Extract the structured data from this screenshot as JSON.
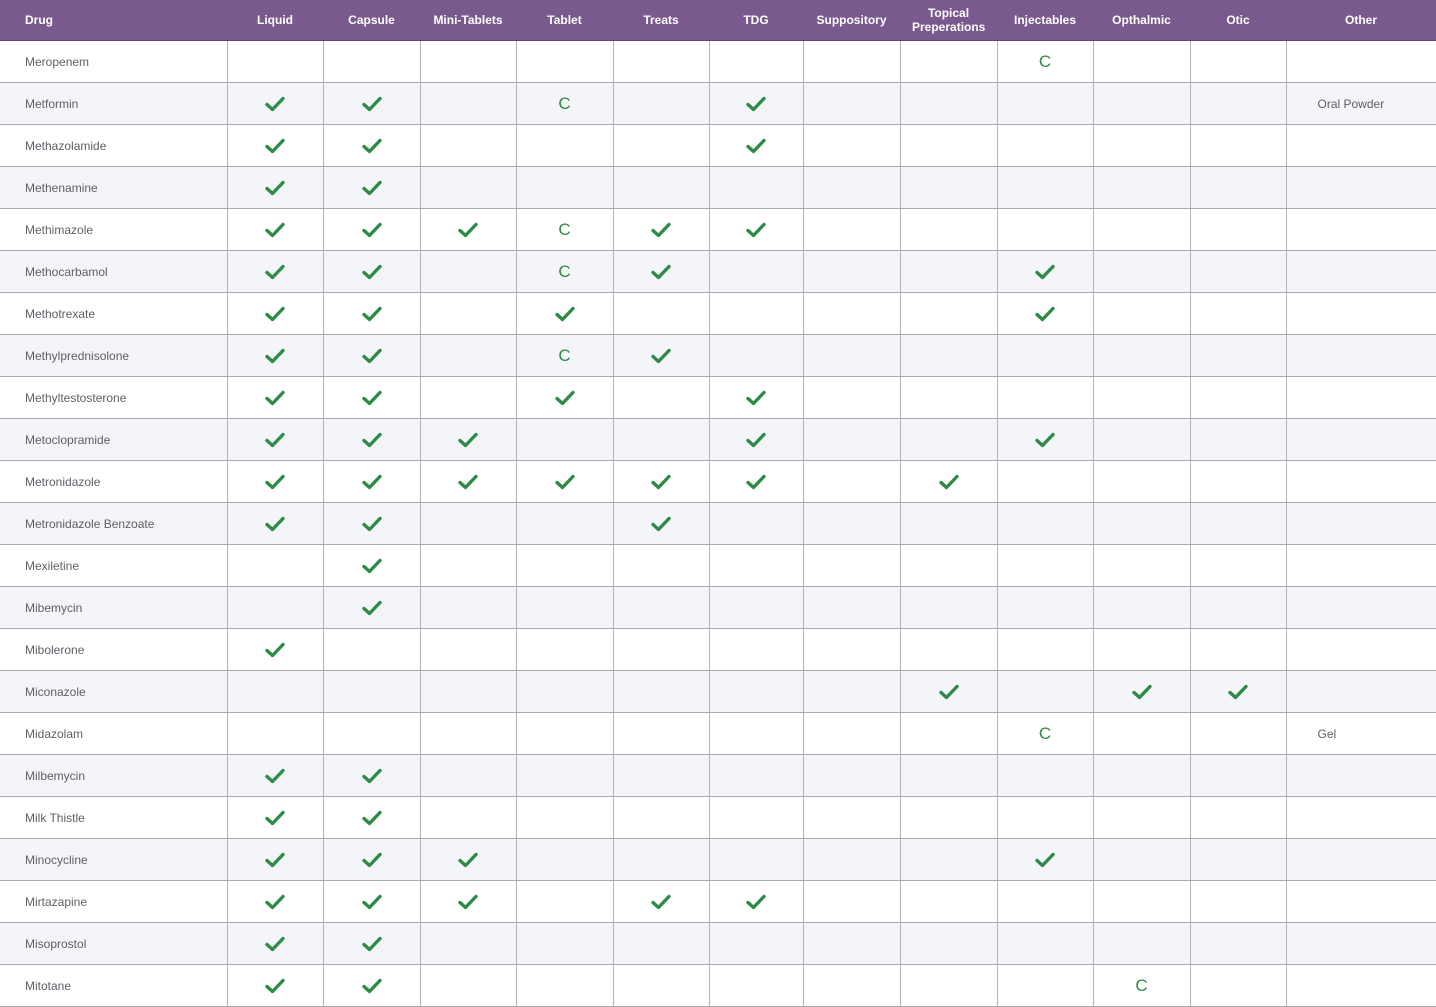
{
  "colors": {
    "header_bg": "#7a5a8e",
    "check": "#2e8b46",
    "row_alt": "#f4f5f9",
    "text": "#5e5e66"
  },
  "legend": {
    "check_icon": "check-icon",
    "c_mark": "C"
  },
  "columns": [
    "Drug",
    "Liquid",
    "Capsule",
    "Mini-Tablets",
    "Tablet",
    "Treats",
    "TDG",
    "Suppository",
    "Topical Preperations",
    "Injectables",
    "Opthalmic",
    "Otic",
    "Other"
  ],
  "rows": [
    {
      "drug": "Meropenem",
      "marks": [
        "",
        "",
        "",
        "",
        "",
        "",
        "",
        "",
        "C",
        "",
        ""
      ],
      "other": ""
    },
    {
      "drug": "Metformin",
      "marks": [
        "check",
        "check",
        "",
        "C",
        "",
        "check",
        "",
        "",
        "",
        "",
        ""
      ],
      "other": "Oral Powder"
    },
    {
      "drug": "Methazolamide",
      "marks": [
        "check",
        "check",
        "",
        "",
        "",
        "check",
        "",
        "",
        "",
        "",
        ""
      ],
      "other": ""
    },
    {
      "drug": "Methenamine",
      "marks": [
        "check",
        "check",
        "",
        "",
        "",
        "",
        "",
        "",
        "",
        "",
        ""
      ],
      "other": ""
    },
    {
      "drug": "Methimazole",
      "marks": [
        "check",
        "check",
        "check",
        "C",
        "check",
        "check",
        "",
        "",
        "",
        "",
        ""
      ],
      "other": ""
    },
    {
      "drug": "Methocarbamol",
      "marks": [
        "check",
        "check",
        "",
        "C",
        "check",
        "",
        "",
        "",
        "check",
        "",
        ""
      ],
      "other": ""
    },
    {
      "drug": "Methotrexate",
      "marks": [
        "check",
        "check",
        "",
        "check",
        "",
        "",
        "",
        "",
        "check",
        "",
        ""
      ],
      "other": ""
    },
    {
      "drug": "Methylprednisolone",
      "marks": [
        "check",
        "check",
        "",
        "C",
        "check",
        "",
        "",
        "",
        "",
        "",
        ""
      ],
      "other": ""
    },
    {
      "drug": "Methyltestosterone",
      "marks": [
        "check",
        "check",
        "",
        "check",
        "",
        "check",
        "",
        "",
        "",
        "",
        ""
      ],
      "other": ""
    },
    {
      "drug": "Metoclopramide",
      "marks": [
        "check",
        "check",
        "check",
        "",
        "",
        "check",
        "",
        "",
        "check",
        "",
        ""
      ],
      "other": ""
    },
    {
      "drug": "Metronidazole",
      "marks": [
        "check",
        "check",
        "check",
        "check",
        "check",
        "check",
        "",
        "check",
        "",
        "",
        ""
      ],
      "other": ""
    },
    {
      "drug": "Metronidazole Benzoate",
      "marks": [
        "check",
        "check",
        "",
        "",
        "check",
        "",
        "",
        "",
        "",
        "",
        ""
      ],
      "other": ""
    },
    {
      "drug": "Mexiletine",
      "marks": [
        "",
        "check",
        "",
        "",
        "",
        "",
        "",
        "",
        "",
        "",
        ""
      ],
      "other": ""
    },
    {
      "drug": "Mibemycin",
      "marks": [
        "",
        "check",
        "",
        "",
        "",
        "",
        "",
        "",
        "",
        "",
        ""
      ],
      "other": ""
    },
    {
      "drug": "Mibolerone",
      "marks": [
        "check",
        "",
        "",
        "",
        "",
        "",
        "",
        "",
        "",
        "",
        ""
      ],
      "other": ""
    },
    {
      "drug": "Miconazole",
      "marks": [
        "",
        "",
        "",
        "",
        "",
        "",
        "",
        "check",
        "",
        "check",
        "check"
      ],
      "other": ""
    },
    {
      "drug": "Midazolam",
      "marks": [
        "",
        "",
        "",
        "",
        "",
        "",
        "",
        "",
        "C",
        "",
        ""
      ],
      "other": "Gel"
    },
    {
      "drug": "Milbemycin",
      "marks": [
        "check",
        "check",
        "",
        "",
        "",
        "",
        "",
        "",
        "",
        "",
        ""
      ],
      "other": ""
    },
    {
      "drug": "Milk Thistle",
      "marks": [
        "check",
        "check",
        "",
        "",
        "",
        "",
        "",
        "",
        "",
        "",
        ""
      ],
      "other": ""
    },
    {
      "drug": "Minocycline",
      "marks": [
        "check",
        "check",
        "check",
        "",
        "",
        "",
        "",
        "",
        "check",
        "",
        ""
      ],
      "other": ""
    },
    {
      "drug": "Mirtazapine",
      "marks": [
        "check",
        "check",
        "check",
        "",
        "check",
        "check",
        "",
        "",
        "",
        "",
        ""
      ],
      "other": ""
    },
    {
      "drug": "Misoprostol",
      "marks": [
        "check",
        "check",
        "",
        "",
        "",
        "",
        "",
        "",
        "",
        "",
        ""
      ],
      "other": ""
    },
    {
      "drug": "Mitotane",
      "marks": [
        "check",
        "check",
        "",
        "",
        "",
        "",
        "",
        "",
        "",
        "C",
        ""
      ],
      "other": ""
    }
  ]
}
